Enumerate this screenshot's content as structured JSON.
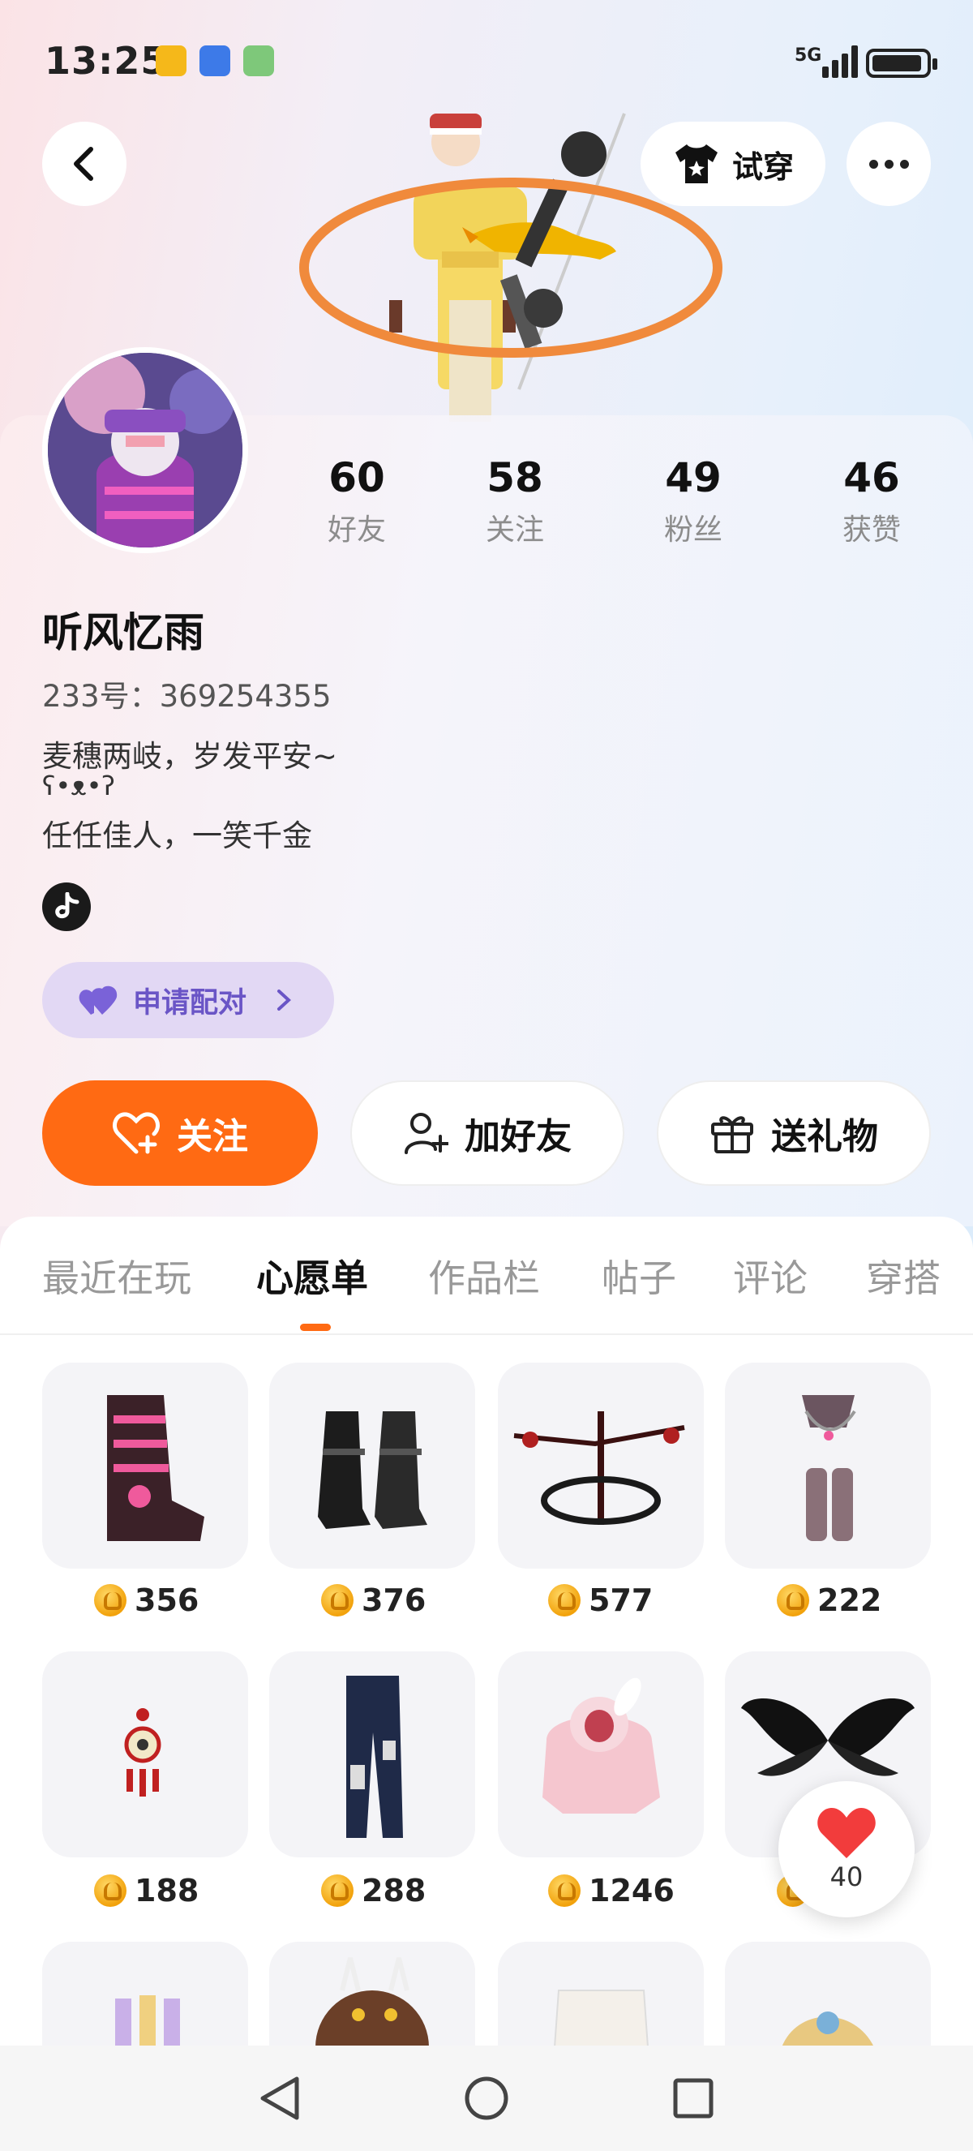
{
  "status_bar": {
    "time": "13:25",
    "network": "5G",
    "notification_icons": [
      "heart-app-icon",
      "security-app-icon",
      "game-app-icon"
    ]
  },
  "header": {
    "back_icon": "chevron-left-icon",
    "tryon_label": "试穿",
    "more_icon": "more-dots-icon"
  },
  "profile": {
    "stats": [
      {
        "value": "60",
        "label": "好友"
      },
      {
        "value": "58",
        "label": "关注"
      },
      {
        "value": "49",
        "label": "粉丝"
      },
      {
        "value": "46",
        "label": "获赞"
      }
    ],
    "username": "听风忆雨",
    "user_id": "233号：369254355",
    "bio": [
      "麦穗两岐，岁发平安~",
      "ʕ•ᴥ•ʔ",
      "任任佳人，一笑千金"
    ],
    "pair_label": "申请配对"
  },
  "actions": {
    "follow_label": "关注",
    "add_friend_label": "加好友",
    "gift_label": "送礼物"
  },
  "tabs": [
    {
      "label": "最近在玩",
      "active": false
    },
    {
      "label": "心愿单",
      "active": true
    },
    {
      "label": "作品栏",
      "active": false
    },
    {
      "label": "帖子",
      "active": false
    },
    {
      "label": "评论",
      "active": false
    },
    {
      "label": "穿搭",
      "active": false
    }
  ],
  "wishlist": [
    {
      "item": "pink-black-boots",
      "price": "356"
    },
    {
      "item": "black-strap-boots",
      "price": "376"
    },
    {
      "item": "dark-crossbow-wings",
      "price": "577"
    },
    {
      "item": "chain-leg-accessory",
      "price": "222"
    },
    {
      "item": "red-pendant-accessory",
      "price": "188"
    },
    {
      "item": "denim-pants",
      "price": "288"
    },
    {
      "item": "pink-bunny-hoodie",
      "price": "1246"
    },
    {
      "item": "black-feather-wings",
      "price": ""
    }
  ],
  "like_button": {
    "count": "40"
  },
  "colors": {
    "accent": "#ff6a13",
    "pair_bg": "#e2d8f4",
    "pair_text": "#6a55c6"
  }
}
